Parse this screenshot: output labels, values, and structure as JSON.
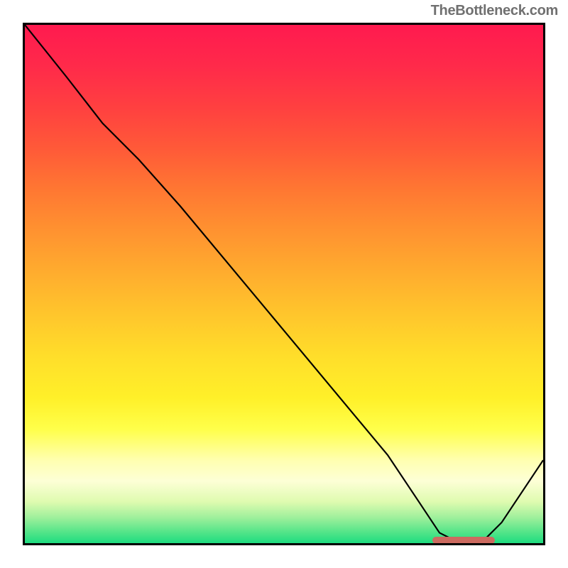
{
  "watermark": "TheBottleneck.com",
  "chart_data": {
    "type": "line",
    "title": "",
    "xlabel": "",
    "ylabel": "",
    "xlim": [
      0,
      100
    ],
    "ylim": [
      0,
      100
    ],
    "series": [
      {
        "name": "curve",
        "x": [
          0,
          8,
          15,
          22,
          30,
          40,
          50,
          60,
          70,
          76,
          80,
          84,
          88,
          92,
          100
        ],
        "values": [
          100,
          90,
          81,
          74,
          65,
          53,
          41,
          29,
          17,
          8,
          2,
          0,
          0,
          4,
          16
        ]
      }
    ],
    "marker": {
      "x_start": 78,
      "x_end": 90,
      "y": 0.5
    },
    "gradient_stops": [
      {
        "pos": 0,
        "color": "#ff1a4f"
      },
      {
        "pos": 50,
        "color": "#ffc62c"
      },
      {
        "pos": 80,
        "color": "#ffff4a"
      },
      {
        "pos": 100,
        "color": "#1edc80"
      }
    ]
  }
}
